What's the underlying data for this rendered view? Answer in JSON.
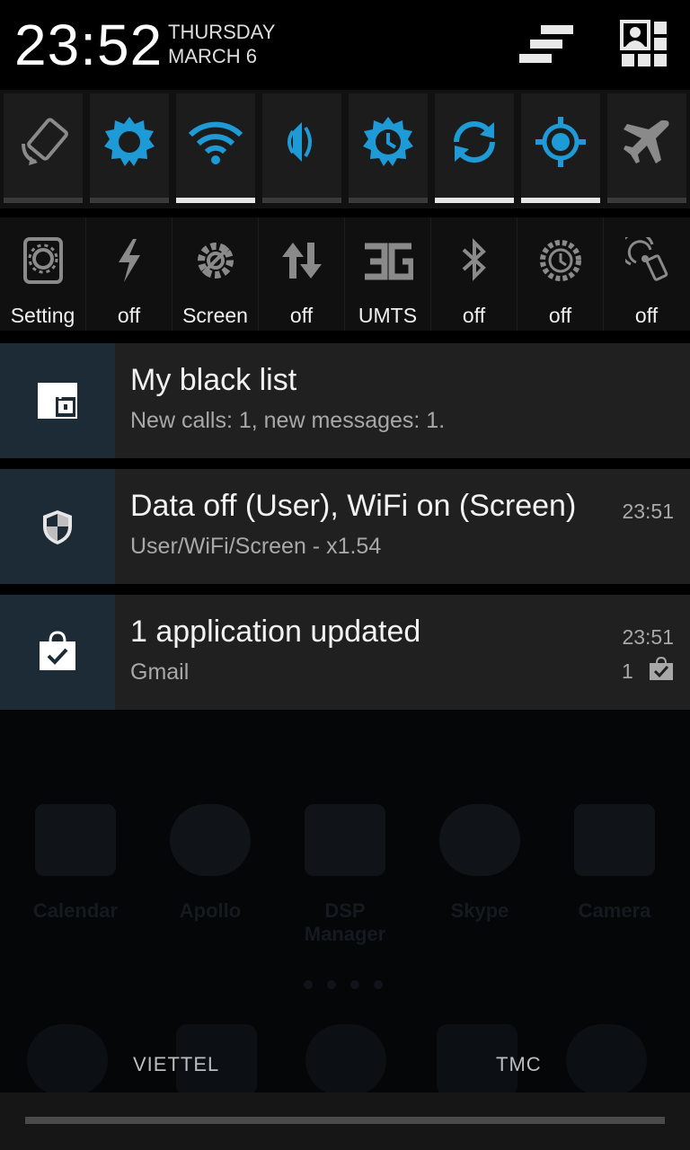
{
  "header": {
    "time": "23:52",
    "day": "THURSDAY",
    "date": "MARCH 6"
  },
  "colors": {
    "accent": "#1e9bd7",
    "icon_grey": "#8a8a8a"
  },
  "toggles_row1": [
    {
      "icon": "auto-rotate-icon",
      "on": false
    },
    {
      "icon": "brightness-icon",
      "on": false
    },
    {
      "icon": "wifi-icon",
      "on": true
    },
    {
      "icon": "sound-icon",
      "on": false
    },
    {
      "icon": "timeout-icon",
      "on": false
    },
    {
      "icon": "sync-icon",
      "on": true
    },
    {
      "icon": "location-icon",
      "on": true
    },
    {
      "icon": "airplane-icon",
      "on": false
    }
  ],
  "toggles_row2": [
    {
      "icon": "settings-icon",
      "label": "Setting"
    },
    {
      "icon": "flashlight-icon",
      "label": "off"
    },
    {
      "icon": "screen-gear-icon",
      "label": "Screen"
    },
    {
      "icon": "data-arrows-icon",
      "label": "off"
    },
    {
      "icon": "3g-icon",
      "label": "UMTS"
    },
    {
      "icon": "bluetooth-icon",
      "label": "off"
    },
    {
      "icon": "timer-icon",
      "label": "off"
    },
    {
      "icon": "nfc-icon",
      "label": "off"
    }
  ],
  "notifications": [
    {
      "title": "My black list",
      "subtitle": "New calls: 1, new messages: 1.",
      "time": ""
    },
    {
      "title": "Data off (User), WiFi on (Screen)",
      "subtitle": "User/WiFi/Screen - x1.54",
      "time": "23:51"
    },
    {
      "title": "1 application updated",
      "subtitle": "Gmail",
      "time": "23:51",
      "count": "1"
    }
  ],
  "carriers": {
    "left": "VIETTEL",
    "right": "TMC"
  },
  "background_apps": [
    "Calendar",
    "Apollo",
    "DSP Manager",
    "Skype",
    "Camera"
  ]
}
